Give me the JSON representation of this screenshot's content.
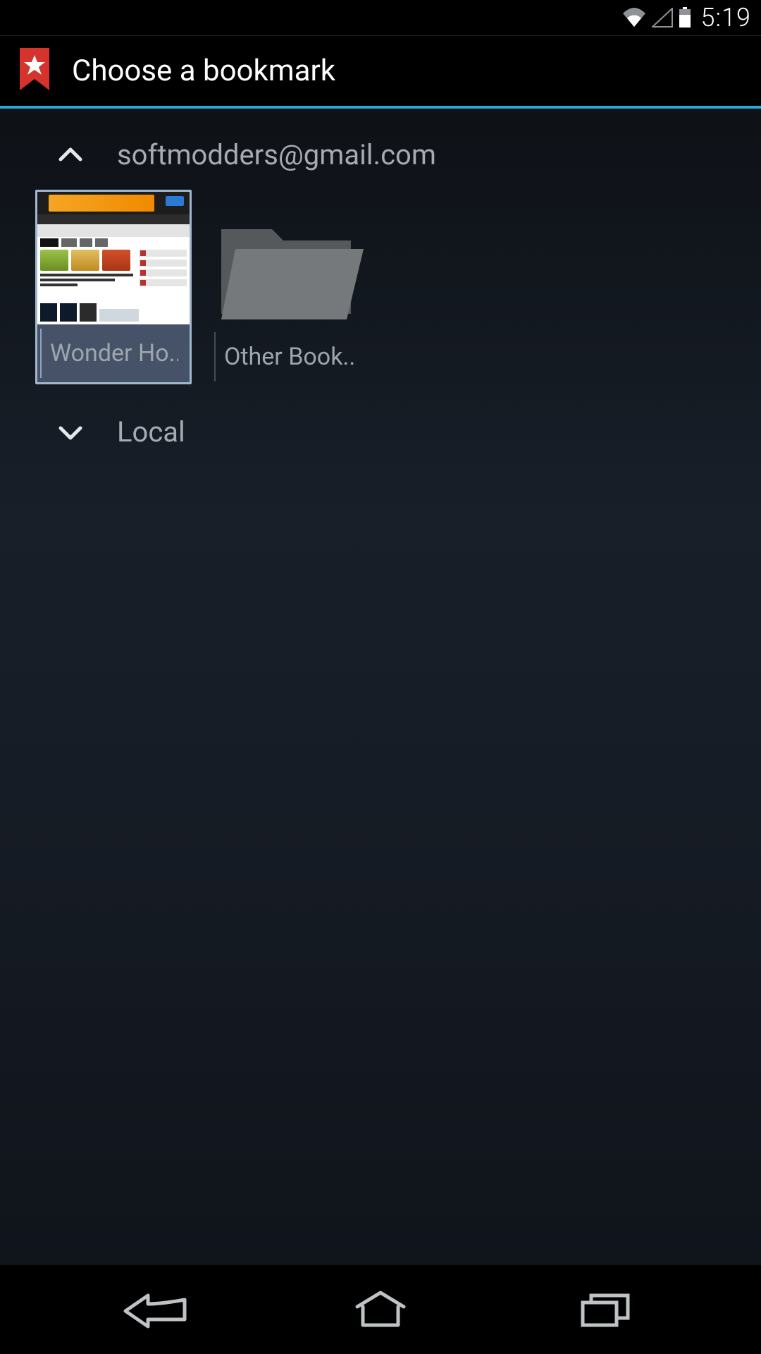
{
  "status": {
    "time": "5:19"
  },
  "header": {
    "title": "Choose a bookmark"
  },
  "sections": [
    {
      "expanded": true,
      "label": "softmodders@gmail.com",
      "items": [
        {
          "type": "bookmark",
          "label": "Wonder Ho..",
          "selected": true
        },
        {
          "type": "folder",
          "label": "Other Book.."
        }
      ]
    },
    {
      "expanded": false,
      "label": "Local"
    }
  ]
}
